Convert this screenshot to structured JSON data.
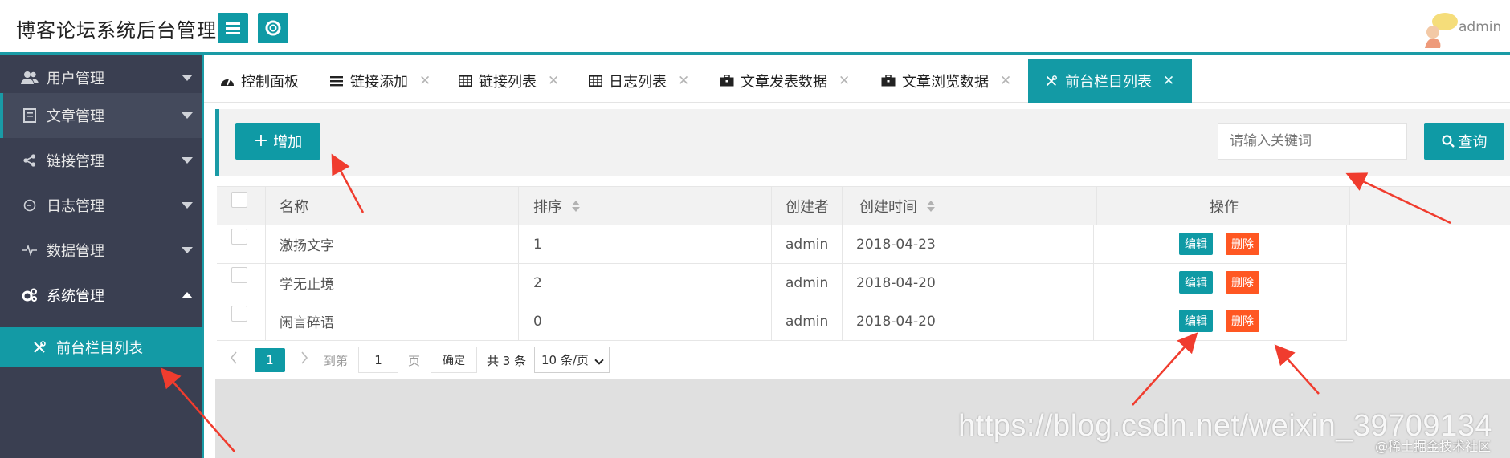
{
  "header": {
    "app_title": "博客论坛系统后台管理",
    "username": "admin"
  },
  "sidebar": {
    "items": [
      {
        "label": "用户管理",
        "icon": "users-icon"
      },
      {
        "label": "文章管理",
        "icon": "document-icon"
      },
      {
        "label": "链接管理",
        "icon": "share-icon"
      },
      {
        "label": "日志管理",
        "icon": "log-icon"
      },
      {
        "label": "数据管理",
        "icon": "pulse-icon"
      },
      {
        "label": "系统管理",
        "icon": "gears-icon"
      }
    ],
    "sub_item": {
      "label": "前台栏目列表",
      "icon": "tools-icon"
    }
  },
  "tabs": [
    {
      "label": "控制面板",
      "icon": "dashboard-icon",
      "closable": false
    },
    {
      "label": "链接添加",
      "icon": "list-icon",
      "closable": true
    },
    {
      "label": "链接列表",
      "icon": "table-icon",
      "closable": true
    },
    {
      "label": "日志列表",
      "icon": "table-icon",
      "closable": true
    },
    {
      "label": "文章发表数据",
      "icon": "briefcase-icon",
      "closable": true
    },
    {
      "label": "文章浏览数据",
      "icon": "briefcase-icon",
      "closable": true
    },
    {
      "label": "前台栏目列表",
      "icon": "tools-icon",
      "closable": true,
      "active": true
    }
  ],
  "close_glyph": "✕",
  "toolbar": {
    "add_label": "增加",
    "search_placeholder": "请输入关键词",
    "search_label": "查询"
  },
  "table": {
    "columns": [
      "名称",
      "排序",
      "创建者",
      "创建时间",
      "操作"
    ],
    "rows": [
      {
        "name": "激扬文字",
        "order": "1",
        "creator": "admin",
        "created": "2018-04-23"
      },
      {
        "name": "学无止境",
        "order": "2",
        "creator": "admin",
        "created": "2018-04-20"
      },
      {
        "name": "闲言碎语",
        "order": "0",
        "creator": "admin",
        "created": "2018-04-20"
      }
    ],
    "edit_label": "编辑",
    "delete_label": "删除"
  },
  "pagination": {
    "current_page": "1",
    "goto_label": "到第",
    "page_input": "1",
    "page_unit": "页",
    "confirm_label": "确定",
    "total_label": "共 3 条",
    "page_size": "10 条/页"
  },
  "watermark": {
    "url": "https://blog.csdn.net/weixin_39709134",
    "site": "@稀土掘金技术社区"
  },
  "colors": {
    "accent": "#0f9aa5",
    "sidebar_bg": "#3a3f51",
    "danger": "#ff5722",
    "arrow": "#f03c2e"
  }
}
